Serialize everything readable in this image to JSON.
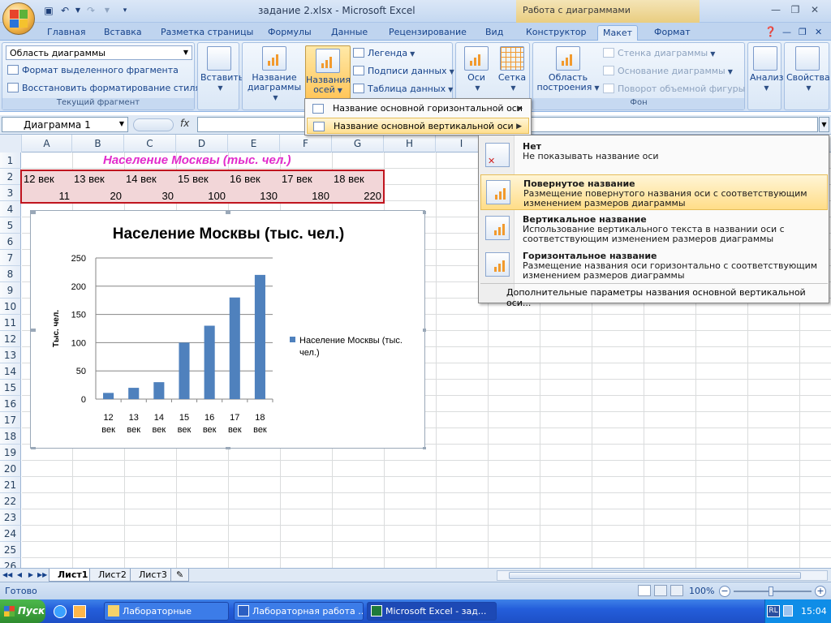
{
  "window": {
    "title": "задание 2.xlsx - Microsoft Excel",
    "context_title": "Работа с диаграммами"
  },
  "tabs": [
    "Главная",
    "Вставка",
    "Разметка страницы",
    "Формулы",
    "Данные",
    "Рецензирование",
    "Вид",
    "Конструктор",
    "Макет",
    "Формат"
  ],
  "ribbon": {
    "current_fragment": {
      "selector_value": "Область диаграммы",
      "format_selection": "Формат выделенного фрагмента",
      "reset_style": "Восстановить форматирование стиля",
      "group_label": "Текущий фрагмент"
    },
    "insert_label": "Вставить",
    "chart_title_label": "Название диаграммы",
    "axis_titles_label": "Названия осей",
    "legend_label": "Легенда",
    "data_labels_label": "Подписи данных",
    "data_table_label": "Таблица данных",
    "axes_label": "Оси",
    "gridlines_label": "Сетка",
    "plot_area_label": "Область построения",
    "chart_wall_label": "Стенка диаграммы",
    "chart_floor_label": "Основание диаграммы",
    "rotation_label": "Поворот объемной фигуры",
    "background_group_label": "Фон",
    "analysis_label": "Анализ",
    "properties_label": "Свойства"
  },
  "formula_bar": {
    "name_box": "Диаграмма 1",
    "fx_label": "fx",
    "value": ""
  },
  "columns": [
    "A",
    "B",
    "C",
    "D",
    "E",
    "F",
    "G",
    "H",
    "I"
  ],
  "rows": [
    "1",
    "2",
    "3",
    "4",
    "5",
    "6",
    "7",
    "8",
    "9",
    "10",
    "11",
    "12",
    "13",
    "14",
    "15",
    "16",
    "17",
    "18",
    "19",
    "20",
    "21",
    "22",
    "23",
    "24",
    "25",
    "26"
  ],
  "sheet": {
    "title": "Население Москвы (тыс. чел.)",
    "row2": [
      "12 век",
      "13 век",
      "14 век",
      "15 век",
      "16 век",
      "17 век",
      "18 век"
    ],
    "row3": [
      "11",
      "20",
      "30",
      "100",
      "130",
      "180",
      "220"
    ]
  },
  "chart_data": {
    "type": "bar",
    "title": "Население Москвы (тыс. чел.)",
    "categories": [
      "12 век",
      "13 век",
      "14 век",
      "15 век",
      "16 век",
      "17 век",
      "18 век"
    ],
    "series": [
      {
        "name": "Население Москвы (тыс. чел.)",
        "values": [
          11,
          20,
          30,
          100,
          130,
          180,
          220
        ],
        "color": "#4f81bd"
      }
    ],
    "ylabel": "Тыс. чел.",
    "xlabel": "",
    "ylim": [
      0,
      250
    ],
    "yticks": [
      "0",
      "50",
      "100",
      "150",
      "200",
      "250"
    ],
    "grid": true,
    "legend_position": "right"
  },
  "menu_axis": {
    "horizontal": "Название основной горизонтальной оси",
    "vertical": "Название основной вертикальной оси"
  },
  "menu_vertical": {
    "options": [
      {
        "title": "Нет",
        "desc": "Не показывать название оси"
      },
      {
        "title": "Повернутое название",
        "desc": "Размещение повернутого названия оси с соответствующим изменением размеров диаграммы"
      },
      {
        "title": "Вертикальное название",
        "desc": "Использование вертикального текста в названии оси с соответствующим изменением размеров диаграммы"
      },
      {
        "title": "Горизонтальное название",
        "desc": "Размещение названия оси горизонтально с соответствующим изменением размеров диаграммы"
      }
    ],
    "more": "Дополнительные параметры названия основной вертикальной оси..."
  },
  "sheet_tabs": [
    "Лист1",
    "Лист2",
    "Лист3"
  ],
  "status": {
    "ready": "Готово",
    "zoom": "100%"
  },
  "taskbar": {
    "start": "Пуск",
    "tasks": [
      "Лабораторные",
      "Лабораторная работа ...",
      "Microsoft Excel - зад..."
    ],
    "lang": "RL",
    "time": "15:04"
  },
  "colors": {
    "bar": "#4f81bd",
    "highlight": "#ffdf8f",
    "sheet_title": "#e22bcc",
    "range_border": "#c0141e"
  }
}
